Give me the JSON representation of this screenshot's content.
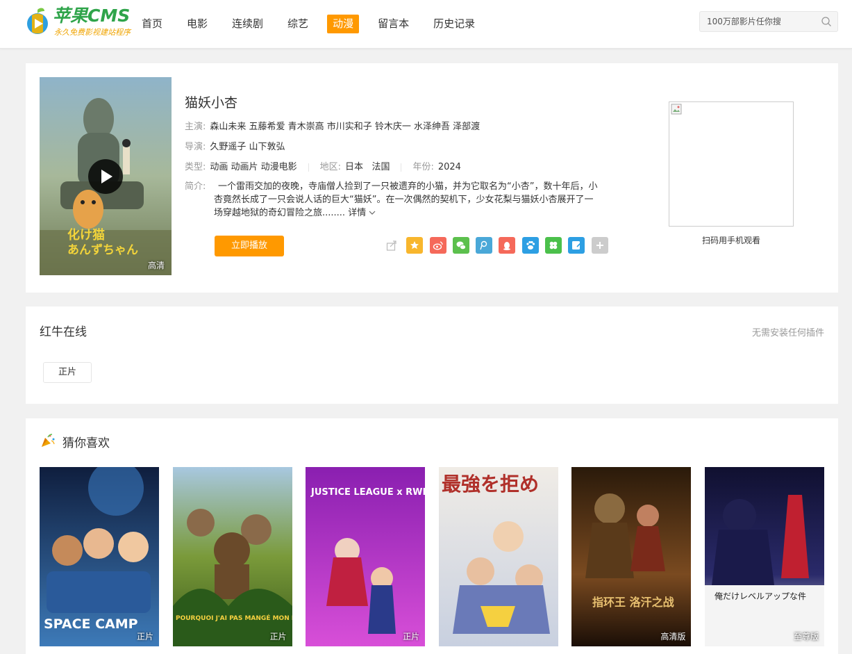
{
  "header": {
    "logo_title": "苹果CMS",
    "logo_subtitle": "永久免费影视建站程序",
    "nav": [
      {
        "label": "首页",
        "active": false
      },
      {
        "label": "电影",
        "active": false
      },
      {
        "label": "连续剧",
        "active": false
      },
      {
        "label": "综艺",
        "active": false
      },
      {
        "label": "动漫",
        "active": true
      },
      {
        "label": "留言本",
        "active": false
      },
      {
        "label": "历史记录",
        "active": false
      }
    ],
    "search_placeholder": "100万部影片任你搜"
  },
  "detail": {
    "title": "猫妖小杏",
    "poster_badge": "高清",
    "poster_text_jp_1": "化け猫",
    "poster_text_jp_2": "あんずちゃん",
    "actors_label": "主演:",
    "actors": "森山未来 五藤希爱 青木崇高 市川实和子 铃木庆一 水泽绅吾 泽部渡",
    "director_label": "导演:",
    "director": "久野遥子 山下敦弘",
    "type_label": "类型:",
    "type": "动画 动画片 动漫电影",
    "region_label": "地区:",
    "region": "日本   法国",
    "year_label": "年份:",
    "year": "2024",
    "desc_label": "简介:",
    "desc": "一个雷雨交加的夜晚，寺庙僧人捡到了一只被遗弃的小猫，并为它取名为“小杏”，数十年后，小杏竟然长成了一只会说人话的巨大“猫妖”。在一次偶然的契机下，少女花梨与猫妖小杏展开了一场穿越地狱的奇幻冒险之旅........",
    "more_label": "详情",
    "play_button": "立即播放",
    "qr_label": "扫码用手机观看",
    "share_colors": [
      "#ffffff",
      "#f8b62d",
      "#f5695a",
      "#5cc04d",
      "#4aa8d8",
      "#f5695a",
      "#2d9fe3",
      "#4bc04b",
      "#2d9fe3",
      "#cccccc"
    ]
  },
  "source": {
    "title": "红牛在线",
    "note": "无需安装任何插件",
    "episode": "正片"
  },
  "recommend": {
    "title": "猜你喜欢",
    "items": [
      {
        "badge": "正片",
        "poster_text": "SPACE CAMP",
        "colors": [
          "#1a2f5a",
          "#3d7ab8"
        ]
      },
      {
        "badge": "正片",
        "poster_text": "POURQUOI J'AI PAS MANGÉ MON PÈRE",
        "colors": [
          "#5a7a2a",
          "#c8a550"
        ]
      },
      {
        "badge": "正片",
        "poster_text": "JUSTICE LEAGUE x RWBY",
        "colors": [
          "#8a1fb0",
          "#d84fd8"
        ]
      },
      {
        "badge": "",
        "poster_text": "最強を拒め",
        "colors": [
          "#e8e0d8",
          "#6a8ac0"
        ]
      },
      {
        "badge": "高清版",
        "poster_text": "指环王 洛汗之战",
        "colors": [
          "#3a2212",
          "#8a5a2a"
        ]
      },
      {
        "badge": "至尊版",
        "poster_text": "俺だけレベルアップな件",
        "colors": [
          "#1a1a4a",
          "#c02030"
        ]
      }
    ]
  }
}
